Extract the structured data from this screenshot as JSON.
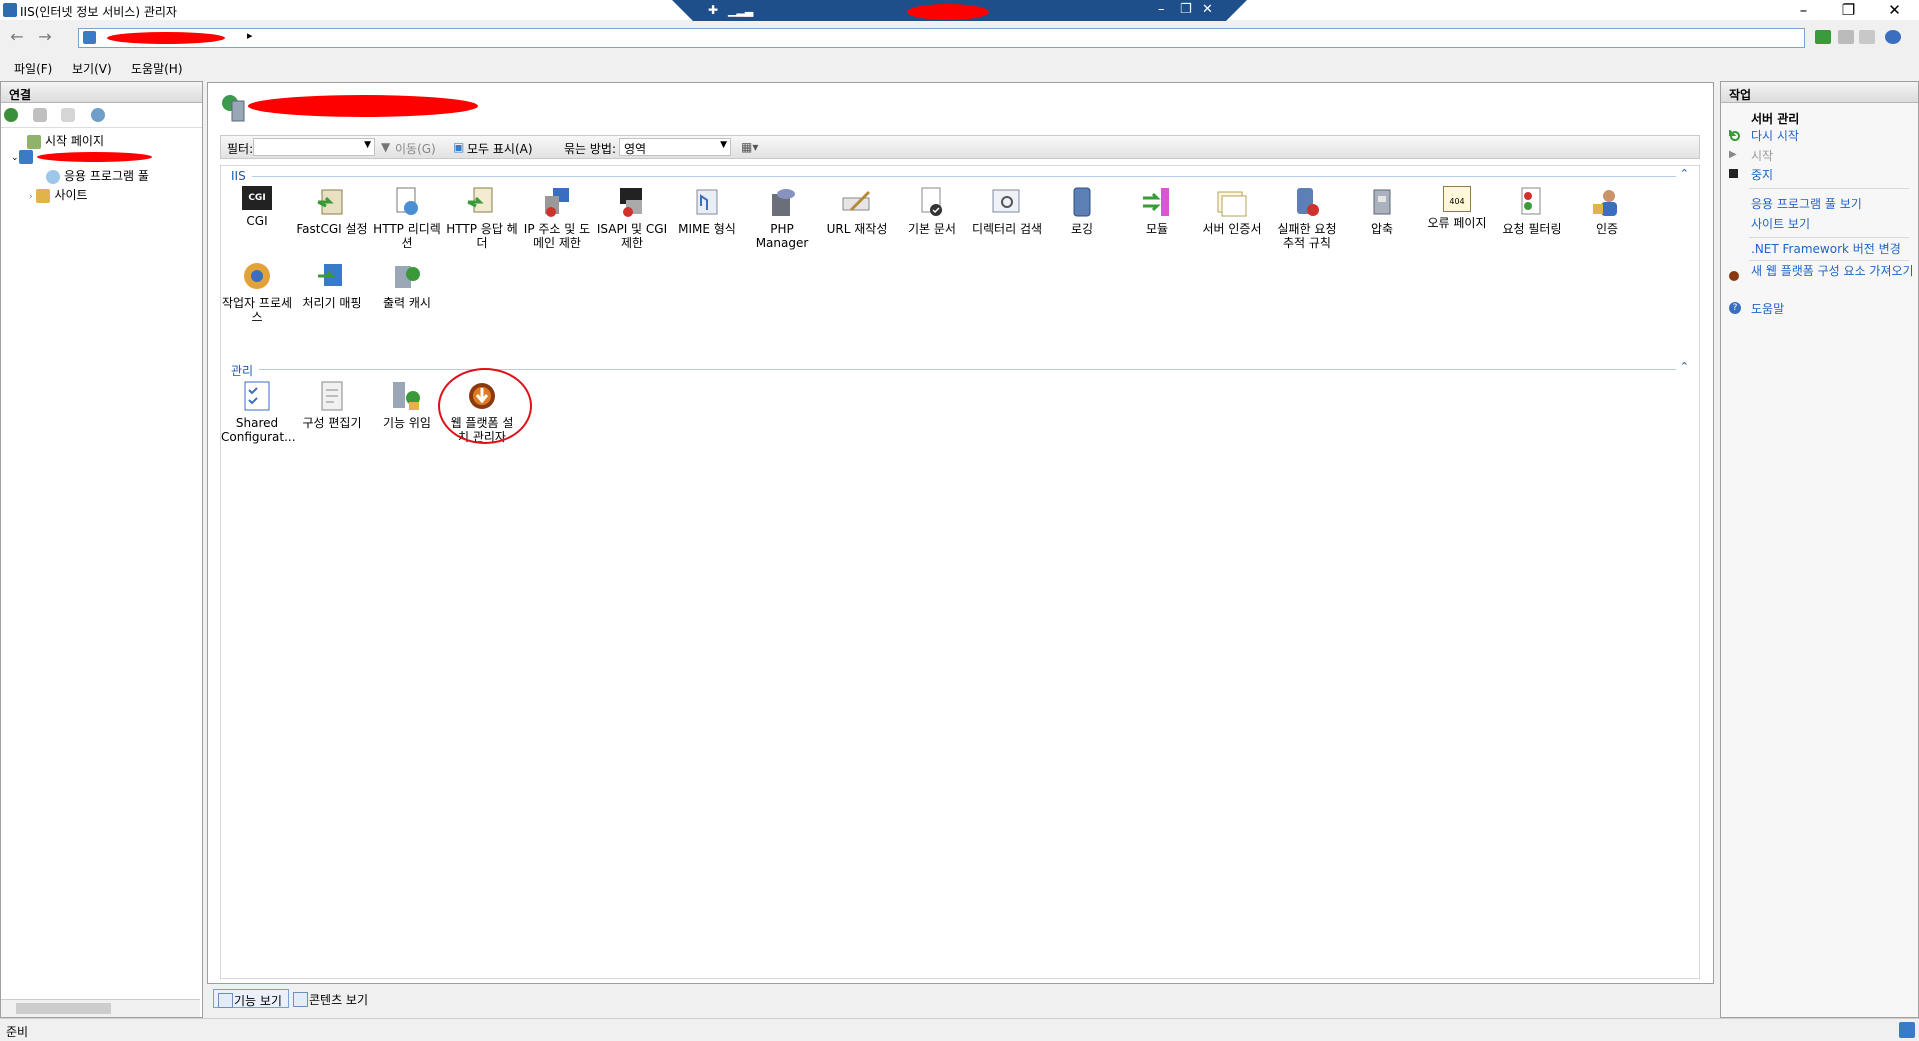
{
  "window": {
    "title": "IIS(인터넷 정보 서비스) 관리자"
  },
  "menu": [
    "파일(F)",
    "보기(V)",
    "도움말(H)"
  ],
  "connections": {
    "header": "연결",
    "tree": [
      {
        "label": "시작 페이지"
      },
      {
        "label": ""
      },
      {
        "label": "응용 프로그램 풀"
      },
      {
        "label": "사이트"
      }
    ]
  },
  "filter": {
    "label": "필터:",
    "go": "이동(G)",
    "show_all": "모두 표시(A)",
    "group_label": "묶는 방법:",
    "group_value": "영역"
  },
  "groups": {
    "iis": "IIS",
    "mgmt": "관리"
  },
  "features_iis_row1": [
    "CGI",
    "FastCGI 설정",
    "HTTP 리디렉션",
    "HTTP 응답 헤더",
    "IP 주소 및 도메인 제한",
    "ISAPI 및 CGI 제한",
    "MIME 형식",
    "PHP Manager",
    "URL 재작성",
    "기본 문서",
    "디렉터리 검색",
    "로깅",
    "모듈",
    "서버 인증서",
    "실패한 요청 추적 규칙",
    "압축",
    "오류 페이지",
    "요청 필터링",
    "인증"
  ],
  "features_iis_row2": [
    "작업자 프로세스",
    "처리기 매핑",
    "출력 캐시"
  ],
  "features_mgmt": [
    "Shared Configurat...",
    "구성 편집기",
    "기능 위임",
    "웹 플랫폼 설치 관리자"
  ],
  "cgi_icon_text": "CGI",
  "error_icon_text": "404",
  "views": {
    "features": "기능 보기",
    "content": "콘텐츠 보기"
  },
  "actions": {
    "header": "작업",
    "title": "서버 관리",
    "restart": "다시 시작",
    "start": "시작",
    "stop": "중지",
    "view_pools": "응용 프로그램 풀 보기",
    "view_sites": "사이트 보기",
    "net_version": ".NET Framework 버전 변경",
    "get_components": "새 웹 플랫폼 구성 요소 가져오기",
    "help": "도움말"
  },
  "status": "준비"
}
